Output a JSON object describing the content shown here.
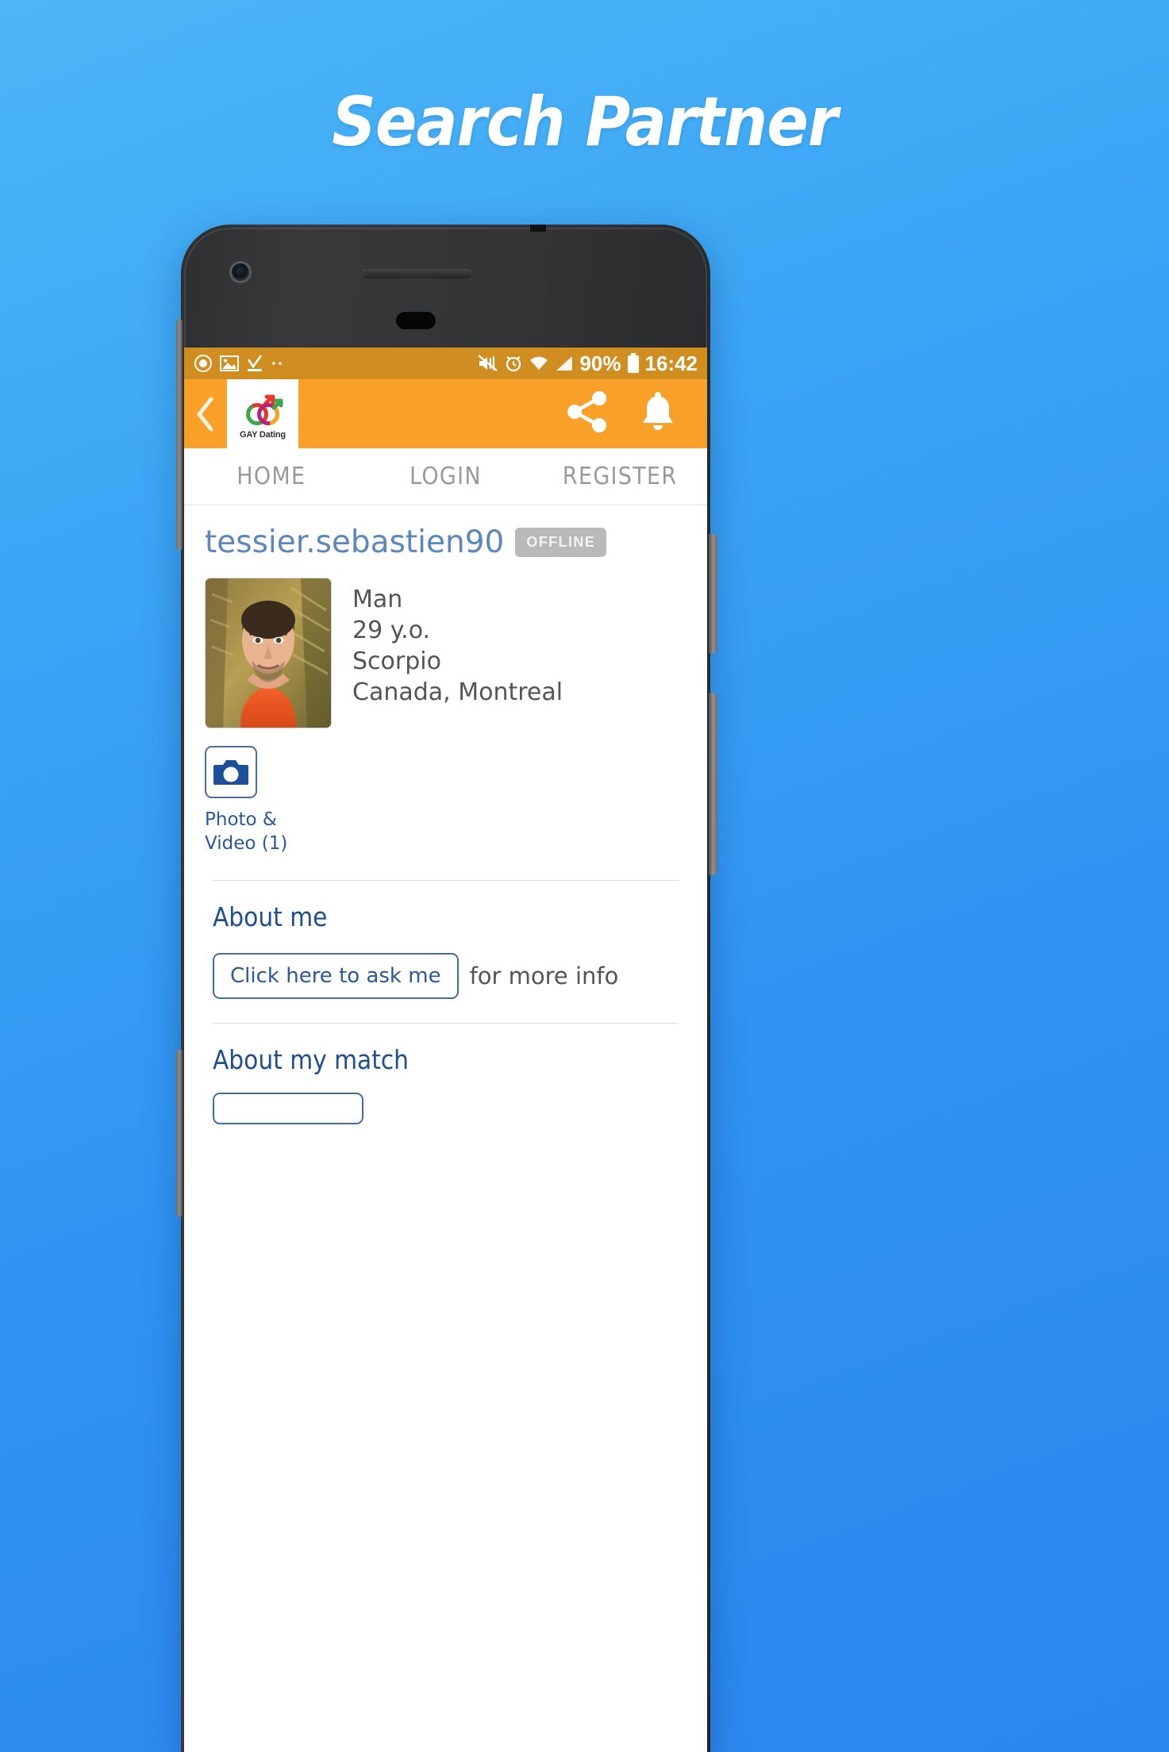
{
  "promo": {
    "title": "Search Partner"
  },
  "statusbar": {
    "icons_left": [
      "record-icon",
      "gallery-icon",
      "download-complete-icon",
      "more-icon"
    ],
    "icons_right": [
      "mute-icon",
      "alarm-icon",
      "wifi-icon",
      "signal-icon"
    ],
    "battery_percent": "90%",
    "battery_icon": "battery-icon",
    "time": "16:42"
  },
  "appbar": {
    "back_icon": "back-chevron-icon",
    "logo_text": "GAY Dating",
    "logo_icon": "gay-dating-logo-icon",
    "share_icon": "share-icon",
    "bell_icon": "bell-icon",
    "background": "#f9a028"
  },
  "tabs": [
    {
      "label": "HOME"
    },
    {
      "label": "LOGIN"
    },
    {
      "label": "REGISTER"
    }
  ],
  "profile": {
    "username": "tessier.sebastien90",
    "status_badge": "OFFLINE",
    "avatar_alt": "profile-photo",
    "facts": [
      "Man",
      "29 y.o.",
      "Scorpio",
      "Canada, Montreal"
    ],
    "media": {
      "icon": "camera-icon",
      "label": "Photo & Video (1)"
    }
  },
  "sections": {
    "about_me": {
      "title": "About me",
      "button_label": "Click here to ask me",
      "suffix": "for more info"
    },
    "about_my_match": {
      "title": "About my match"
    }
  },
  "colors": {
    "accent_orange": "#f9a028",
    "status_orange": "#d08e21",
    "link_blue": "#2a5899",
    "username_blue": "#5b87bd",
    "page_blue": "#3ba5f5"
  }
}
